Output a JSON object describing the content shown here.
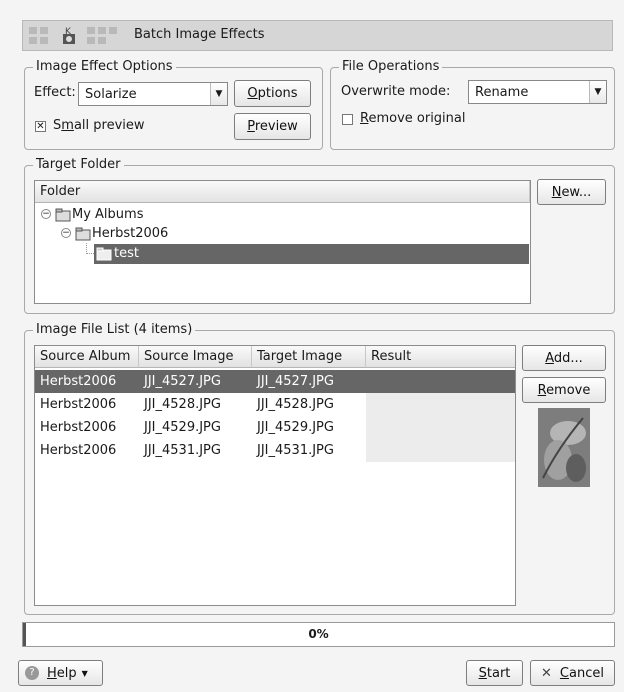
{
  "window": {
    "title": "Batch Image Effects"
  },
  "effect_options": {
    "legend": "Image Effect Options",
    "effect_label": "Effect:",
    "effect_value": "Solarize",
    "options_button": "Options",
    "options_mnemonic": "O",
    "small_preview_pre": "S",
    "small_preview_mn": "m",
    "small_preview_post": "all preview",
    "small_preview_checked": true,
    "preview_button_mn": "P",
    "preview_button_rest": "review"
  },
  "file_ops": {
    "legend": "File Operations",
    "overwrite_label": "Overwrite mode:",
    "overwrite_value": "Rename",
    "remove_original_mn": "R",
    "remove_original_rest": "emove original",
    "remove_original_checked": false
  },
  "target_folder": {
    "legend": "Target Folder",
    "column_header": "Folder",
    "new_button_mn": "N",
    "new_button_rest": "ew...",
    "tree": [
      {
        "label": "My Albums",
        "level": 0,
        "expanded": true,
        "selected": false
      },
      {
        "label": "Herbst2006",
        "level": 1,
        "expanded": true,
        "selected": false
      },
      {
        "label": "test",
        "level": 2,
        "expanded": false,
        "selected": true
      }
    ]
  },
  "file_list": {
    "legend": "Image File List (4 items)",
    "columns": [
      "Source Album",
      "Source Image",
      "Target Image",
      "Result"
    ],
    "rows": [
      [
        "Herbst2006",
        "JJI_4527.JPG",
        "JJI_4527.JPG",
        ""
      ],
      [
        "Herbst2006",
        "JJI_4528.JPG",
        "JJI_4528.JPG",
        ""
      ],
      [
        "Herbst2006",
        "JJI_4529.JPG",
        "JJI_4529.JPG",
        ""
      ],
      [
        "Herbst2006",
        "JJI_4531.JPG",
        "JJI_4531.JPG",
        ""
      ]
    ],
    "selected_row": 0,
    "add_button_mn": "A",
    "add_button_rest": "dd...",
    "remove_button_mn": "R",
    "remove_button_rest": "emove"
  },
  "progress": {
    "text": "0%",
    "value": 0
  },
  "footer": {
    "help_mn": "H",
    "help_rest": "elp",
    "start_mn": "S",
    "start_rest": "tart",
    "cancel_mn": "C",
    "cancel_rest": "ancel"
  },
  "colors": {
    "selection": "#666666",
    "title_bar": "#d6d6d6"
  }
}
